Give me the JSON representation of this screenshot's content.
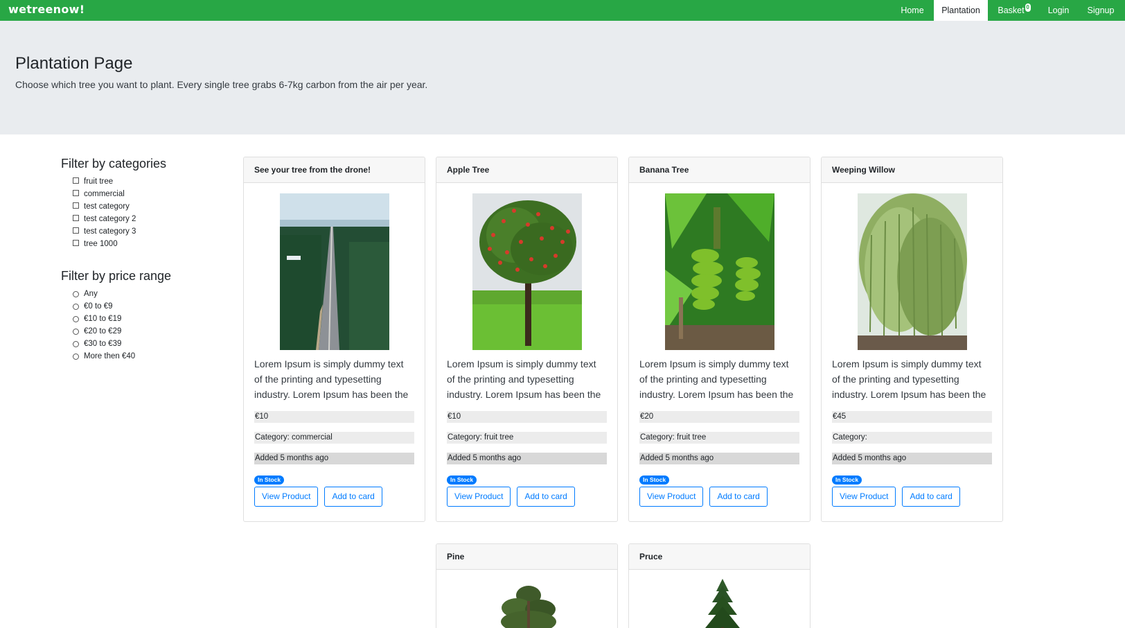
{
  "navbar": {
    "brand": "wetreenow!",
    "items": [
      {
        "label": "Home"
      },
      {
        "label": "Plantation"
      },
      {
        "label": "Basket",
        "badge": "0"
      },
      {
        "label": "Login"
      },
      {
        "label": "Signup"
      }
    ]
  },
  "jumbotron": {
    "title": "Plantation Page",
    "lead": "Choose which tree you want to plant. Every single tree grabs 6-7kg carbon from the air per year."
  },
  "filters": {
    "categories_title": "Filter by categories",
    "categories": [
      "fruit tree",
      "commercial",
      "test category",
      "test category 2",
      "test category 3",
      "tree 1000"
    ],
    "price_title": "Filter by price range",
    "price_ranges": [
      "Any",
      "€0 to €9",
      "€10 to €19",
      "€20 to €29",
      "€30 to €39",
      "More then €40"
    ]
  },
  "products": [
    {
      "title": "See your tree from the drone!",
      "description": "Lorem Ipsum is simply dummy text of the printing and typesetting industry. Lorem Ipsum has been the",
      "price": "€10",
      "category": "Category: commercial",
      "added": "Added 5 months ago",
      "stock": "In Stock",
      "view_label": "View Product",
      "add_label": "Add to card"
    },
    {
      "title": "Apple Tree",
      "description": "Lorem Ipsum is simply dummy text of the printing and typesetting industry. Lorem Ipsum has been the",
      "price": "€10",
      "category": "Category: fruit tree",
      "added": "Added 5 months ago",
      "stock": "In Stock",
      "view_label": "View Product",
      "add_label": "Add to card"
    },
    {
      "title": "Banana Tree",
      "description": "Lorem Ipsum is simply dummy text of the printing and typesetting industry. Lorem Ipsum has been the",
      "price": "€20",
      "category": "Category: fruit tree",
      "added": "Added 5 months ago",
      "stock": "In Stock",
      "view_label": "View Product",
      "add_label": "Add to card"
    },
    {
      "title": "Weeping Willow",
      "description": "Lorem Ipsum is simply dummy text of the printing and typesetting industry. Lorem Ipsum has been the",
      "price": "€45",
      "category": "Category:",
      "added": "Added 5 months ago",
      "stock": "In Stock",
      "view_label": "View Product",
      "add_label": "Add to card"
    },
    {
      "title": "Pine"
    },
    {
      "title": "Pruce"
    }
  ],
  "colors": {
    "navbar": "#28a745",
    "jumbotron": "#e9ecef",
    "primary": "#007bff"
  }
}
